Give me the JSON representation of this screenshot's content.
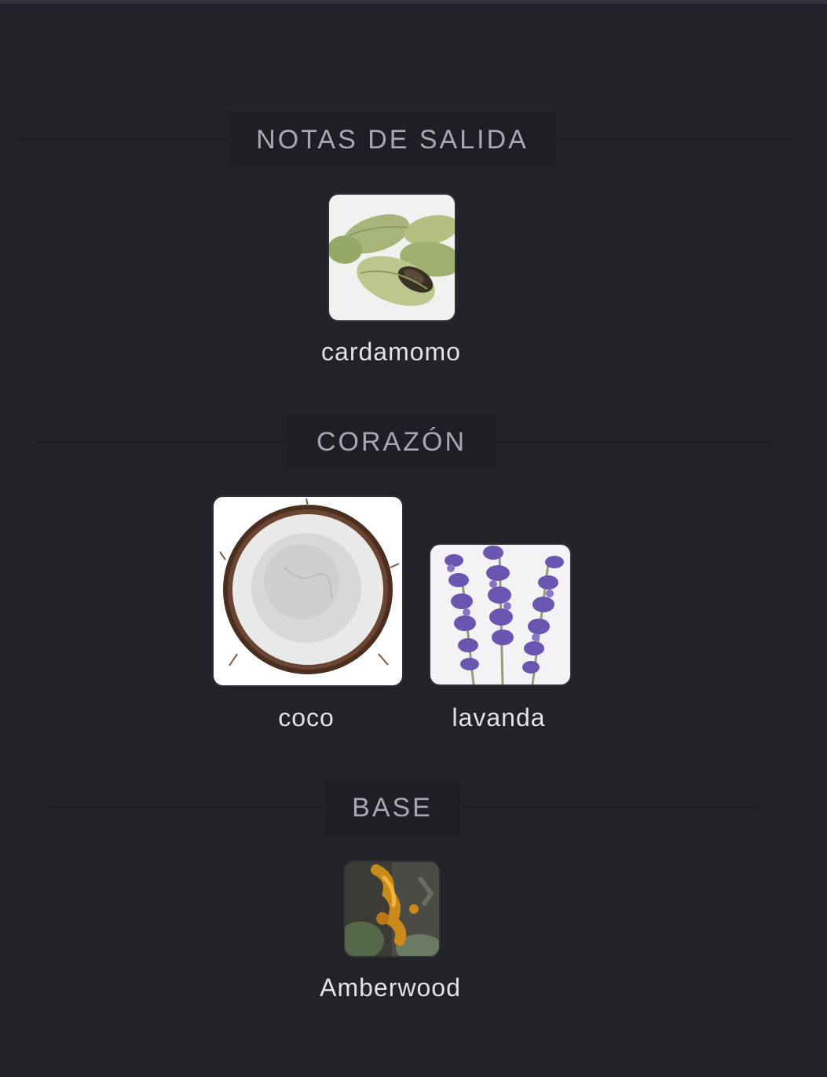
{
  "sections": [
    {
      "title": "NOTAS DE SALIDA",
      "notes": [
        {
          "name": "cardamomo",
          "image": "cardamom-image"
        }
      ]
    },
    {
      "title": "CORAZÓN",
      "notes": [
        {
          "name": "coco",
          "image": "coconut-image"
        },
        {
          "name": "lavanda",
          "image": "lavender-image"
        }
      ]
    },
    {
      "title": "BASE",
      "notes": [
        {
          "name": "Amberwood",
          "image": "amberwood-resin-image"
        }
      ]
    }
  ],
  "colors": {
    "background": "#232229",
    "header_box": "#1f1e24",
    "header_text": "#a9a8b0",
    "note_text": "#e3e2e8"
  }
}
